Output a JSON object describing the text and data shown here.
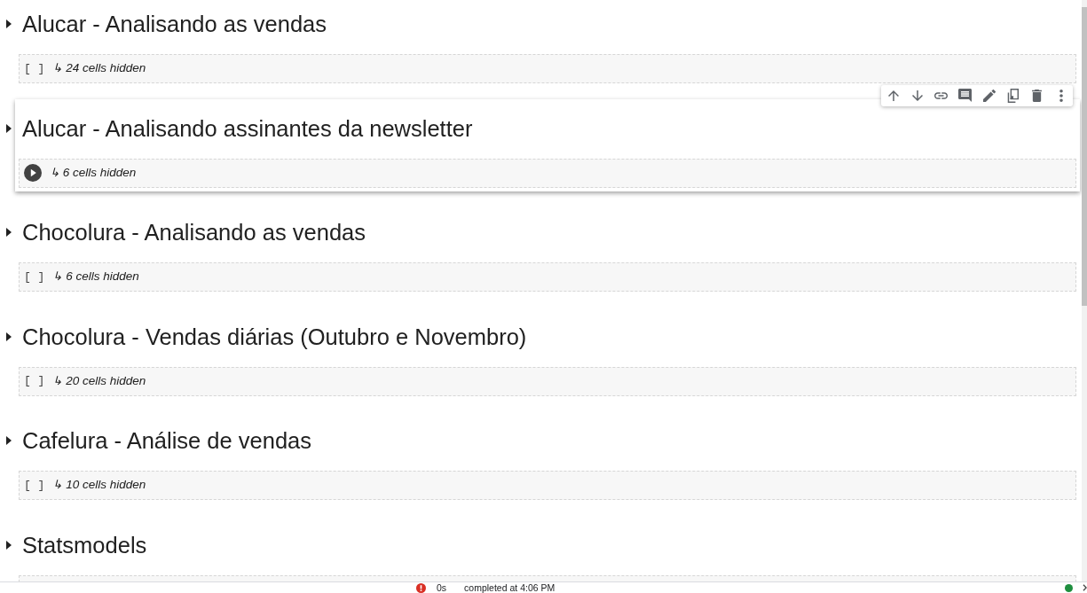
{
  "sections": [
    {
      "title": "Alucar - Analisando as vendas",
      "expanded": false,
      "selected": false,
      "run_label": "[ ]",
      "hidden_cells": "↳ 24 cells hidden"
    },
    {
      "title": "Alucar - Analisando assinantes da newsletter",
      "expanded": false,
      "selected": true,
      "hidden_cells": "↳ 6 cells hidden"
    },
    {
      "title": "Chocolura - Analisando as vendas",
      "expanded": false,
      "selected": false,
      "run_label": "[ ]",
      "hidden_cells": "↳ 6 cells hidden"
    },
    {
      "title": "Chocolura - Vendas diárias (Outubro e Novembro)",
      "expanded": false,
      "selected": false,
      "run_label": "[ ]",
      "hidden_cells": "↳ 20 cells hidden"
    },
    {
      "title": "Cafelura - Análise de vendas",
      "expanded": false,
      "selected": false,
      "run_label": "[ ]",
      "hidden_cells": "↳ 10 cells hidden"
    },
    {
      "title": "Statsmodels",
      "expanded": false,
      "selected": false
    }
  ],
  "status_bar": {
    "duration": "0s",
    "message": "completed at 4:06 PM"
  }
}
